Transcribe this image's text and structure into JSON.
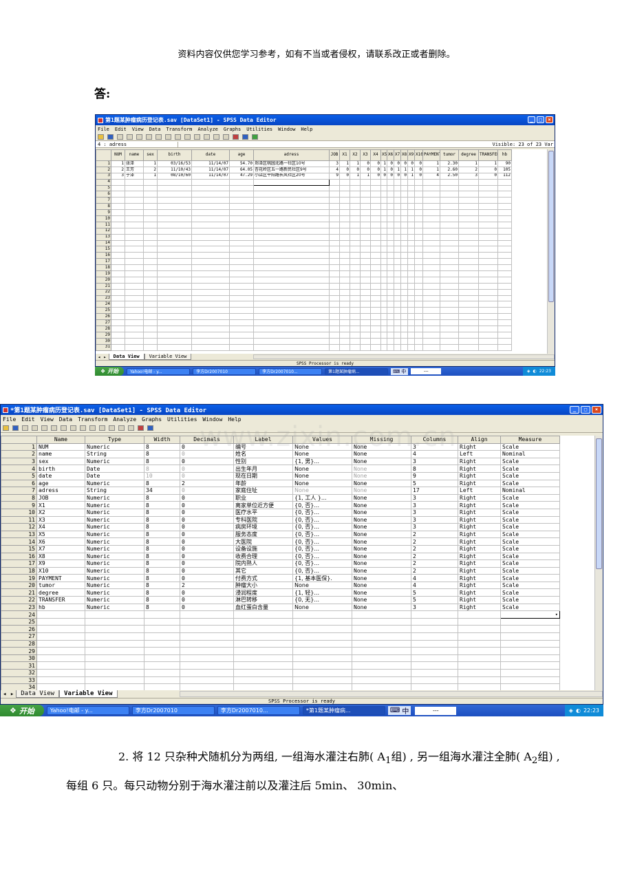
{
  "page": {
    "header_note": "资料内容仅供您学习参考，如有不当或者侵权，请联系改正或者删除。",
    "answer_label": "答:",
    "watermark": "www.zixin.com.cn",
    "paragraph_html": "2. 将 12 只杂种犬随机分为两组, 一组海水灌注右肺( A<sub>1</sub>组) , 另一组海水灌注全肺( A<sub>2</sub>组) , 每组 6 只。每只动物分别于海水灌注前以及灌注后 5min、 30min、"
  },
  "window1": {
    "title": "第1题某肿瘤病历登记表.sav [DataSet1] - SPSS Data Editor",
    "menu": [
      "File",
      "Edit",
      "View",
      "Data",
      "Transform",
      "Analyze",
      "Graphs",
      "Utilities",
      "Window",
      "Help"
    ],
    "cell_ref": "4 : adress",
    "visible": "Visible: 23 of 23 Var",
    "columns": [
      "NUM",
      "name",
      "sex",
      "birth",
      "date",
      "age",
      "adress",
      "JOB",
      "X1",
      "X2",
      "X3",
      "X4",
      "X5",
      "X6",
      "X7",
      "X8",
      "X9",
      "X10",
      "PAYMENT",
      "tumor",
      "degree",
      "TRANSFER",
      "hb"
    ],
    "rows": [
      [
        "1",
        "张泽",
        "1",
        "03/16/53",
        "11/14/07",
        "54.70",
        "郑泽区桃园北路一社区10号",
        "3",
        "1",
        "1",
        "0",
        "0",
        "1",
        "0",
        "0",
        "0",
        "0",
        "0",
        "1",
        "2.30",
        "1",
        "1",
        "90"
      ],
      [
        "2",
        "王芳",
        "2",
        "11/10/43",
        "11/14/07",
        "64.05",
        "杏花岭区五一路新民社区9号",
        "4",
        "0",
        "0",
        "0",
        "0",
        "1",
        "0",
        "1",
        "1",
        "1",
        "0",
        "1",
        "2.60",
        "2",
        "0",
        "105"
      ],
      [
        "3",
        "于泽",
        "1",
        "08/10/60",
        "11/14/07",
        "47.29",
        "小店区平阳路长风社区20号",
        "9",
        "0",
        "1",
        "1",
        "0",
        "0",
        "0",
        "0",
        "0",
        "1",
        "0",
        "4",
        "2.50",
        "3",
        "0",
        "112"
      ]
    ],
    "row_count": 31,
    "tabs": [
      "Data View",
      "Variable View"
    ],
    "status": "SPSS Processor is ready"
  },
  "taskbar1": {
    "start": "开始",
    "tasks": [
      "Yahoo!电邮 - y...",
      "李方Dr2007010",
      "李方Dr2007010...",
      "第1题某肿瘤病..."
    ],
    "ime": "中",
    "ime_box": "---",
    "time": "22:23"
  },
  "window2": {
    "title": "*第1题某肿瘤病历登记表.sav [DataSet1] - SPSS Data Editor",
    "menu": [
      "File",
      "Edit",
      "View",
      "Data",
      "Transform",
      "Analyze",
      "Graphs",
      "Utilities",
      "Window",
      "Help"
    ],
    "columns": [
      "Name",
      "Type",
      "Width",
      "Decimals",
      "Label",
      "Values",
      "Missing",
      "Columns",
      "Align",
      "Measure"
    ],
    "rows": [
      [
        "NUM",
        "Numeric",
        "8",
        "0",
        "编号",
        "None",
        "None",
        "3",
        "Right",
        "Scale"
      ],
      [
        "name",
        "String",
        "8",
        "0",
        "姓名",
        "None",
        "None",
        "4",
        "Left",
        "Nominal"
      ],
      [
        "sex",
        "Numeric",
        "8",
        "0",
        "性别",
        "{1, 男}...",
        "None",
        "3",
        "Right",
        "Scale"
      ],
      [
        "birth",
        "Date",
        "8",
        "0",
        "出生年月",
        "None",
        "None",
        "8",
        "Right",
        "Scale"
      ],
      [
        "date",
        "Date",
        "10",
        "0",
        "现在日期",
        "None",
        "None",
        "9",
        "Right",
        "Scale"
      ],
      [
        "age",
        "Numeric",
        "8",
        "2",
        "年龄",
        "None",
        "None",
        "5",
        "Right",
        "Scale"
      ],
      [
        "adress",
        "String",
        "34",
        "0",
        "家庭住址",
        "None",
        "None",
        "17",
        "Left",
        "Nominal"
      ],
      [
        "JOB",
        "Numeric",
        "8",
        "0",
        "职业",
        "{1, 工人 }...",
        "None",
        "3",
        "Right",
        "Scale"
      ],
      [
        "X1",
        "Numeric",
        "8",
        "0",
        "离家单位近方便",
        "{0, 否}...",
        "None",
        "3",
        "Right",
        "Scale"
      ],
      [
        "X2",
        "Numeric",
        "8",
        "0",
        "医疗水平",
        "{0, 否}...",
        "None",
        "3",
        "Right",
        "Scale"
      ],
      [
        "X3",
        "Numeric",
        "8",
        "0",
        "专科医院",
        "{0, 否}...",
        "None",
        "3",
        "Right",
        "Scale"
      ],
      [
        "X4",
        "Numeric",
        "8",
        "0",
        "病房环境",
        "{0, 否}...",
        "None",
        "3",
        "Right",
        "Scale"
      ],
      [
        "X5",
        "Numeric",
        "8",
        "0",
        "服务态度",
        "{0, 否}...",
        "None",
        "2",
        "Right",
        "Scale"
      ],
      [
        "X6",
        "Numeric",
        "8",
        "0",
        "大医院",
        "{0, 否}...",
        "None",
        "2",
        "Right",
        "Scale"
      ],
      [
        "X7",
        "Numeric",
        "8",
        "0",
        "设备设施",
        "{0, 否}...",
        "None",
        "2",
        "Right",
        "Scale"
      ],
      [
        "X8",
        "Numeric",
        "8",
        "0",
        "收费合理",
        "{0, 否}...",
        "None",
        "2",
        "Right",
        "Scale"
      ],
      [
        "X9",
        "Numeric",
        "8",
        "0",
        "院内熟人",
        "{0, 否}...",
        "None",
        "2",
        "Right",
        "Scale"
      ],
      [
        "X10",
        "Numeric",
        "8",
        "0",
        "其它",
        "{0, 否}...",
        "None",
        "2",
        "Right",
        "Scale"
      ],
      [
        "PAYMENT",
        "Numeric",
        "8",
        "0",
        "付费方式",
        "{1, 基本医保}.",
        "None",
        "4",
        "Right",
        "Scale"
      ],
      [
        "tumor",
        "Numeric",
        "8",
        "2",
        "肿瘤大小",
        "None",
        "None",
        "4",
        "Right",
        "Scale"
      ],
      [
        "degree",
        "Numeric",
        "8",
        "0",
        "浸润程度",
        "{1, 轻}...",
        "None",
        "5",
        "Right",
        "Scale"
      ],
      [
        "TRANSFER",
        "Numeric",
        "8",
        "0",
        "淋巴转移",
        "{0, 无}...",
        "None",
        "5",
        "Right",
        "Scale"
      ],
      [
        "hb",
        "Numeric",
        "8",
        "0",
        "血红蛋白含量",
        "None",
        "None",
        "3",
        "Right",
        "Scale"
      ]
    ],
    "row_count": 34,
    "tabs": [
      "Data View",
      "Variable View"
    ],
    "status": "SPSS Processor is ready"
  },
  "taskbar2": {
    "start": "开始",
    "tasks": [
      "Yahoo!电邮 - y...",
      "李方Dr2007010",
      "李方Dr2007010...",
      "*第1题某肿瘤病..."
    ],
    "ime": "中",
    "ime_box": "---",
    "time": "22:23"
  }
}
